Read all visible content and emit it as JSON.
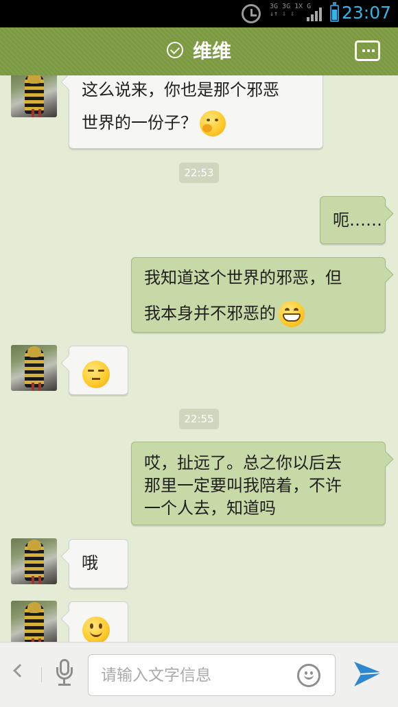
{
  "status_bar": {
    "network_labels": [
      "3G 3G 1X G",
      "↓↑ ⇩ ⇩"
    ],
    "time": "23:07",
    "icons": [
      "alarm-icon",
      "signal-icon",
      "battery-icon"
    ]
  },
  "header": {
    "title": "维维",
    "icons": [
      "check-circle-icon",
      "more-options-icon"
    ],
    "accent_color": "#7c9a42"
  },
  "messages": [
    {
      "side": "left",
      "lines": [
        "这么说来，你也是那个邪恶",
        "世界的一份子？"
      ],
      "emoji": "thinking-emoji"
    },
    {
      "type": "timestamp",
      "text": "22:53"
    },
    {
      "side": "right",
      "lines": [
        "呃……"
      ]
    },
    {
      "side": "right",
      "lines": [
        "我知道这个世界的邪恶，但",
        "我本身并不邪恶的"
      ],
      "emoji": "grin-emoji"
    },
    {
      "side": "left",
      "lines": [],
      "emoji": "smug-emoji"
    },
    {
      "type": "timestamp",
      "text": "22:55"
    },
    {
      "side": "right",
      "lines": [
        "哎，扯远了。总之你以后去",
        "那里一定要叫我陪着，不许",
        "一个人去，知道吗"
      ]
    },
    {
      "side": "left",
      "lines": [
        "哦"
      ]
    },
    {
      "side": "left",
      "lines": [],
      "emoji": "smile-emoji"
    }
  ],
  "input_bar": {
    "placeholder": "请输入文字信息",
    "value": "",
    "icons": [
      "back-arrow-icon",
      "mic-icon",
      "emoji-icon",
      "send-icon"
    ]
  },
  "colors": {
    "chat_background": "#e4ecd5",
    "outgoing_bubble": "#c6d9a6",
    "incoming_bubble": "#f6f6f4",
    "clock": "#33b5e5"
  }
}
